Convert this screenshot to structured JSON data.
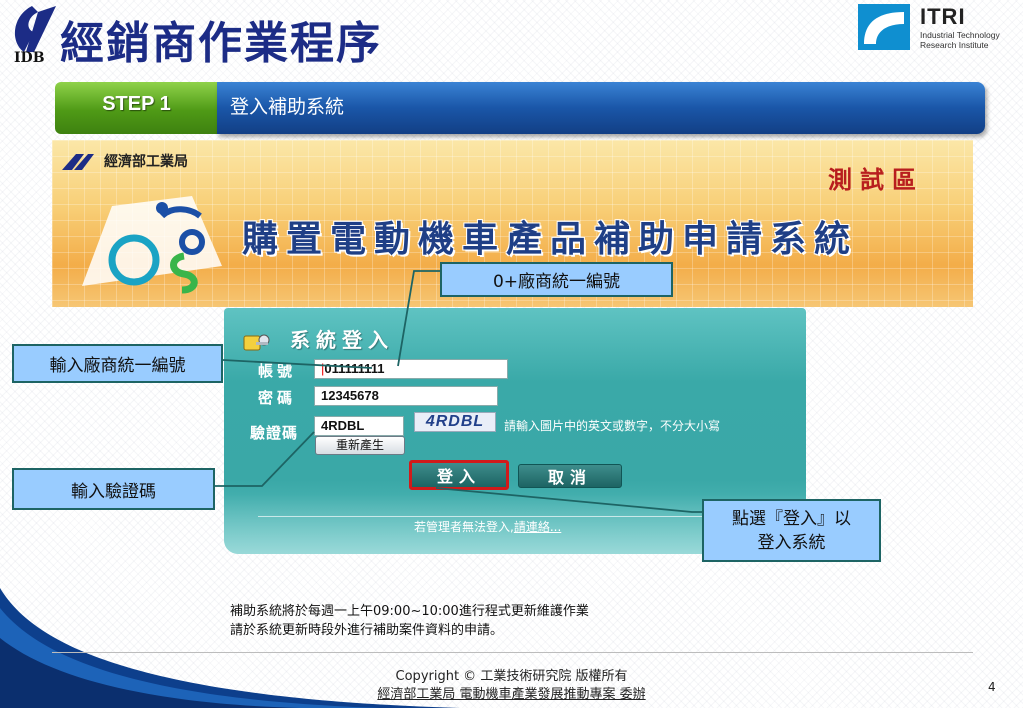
{
  "header": {
    "logo_text": "IDB",
    "title": "經銷商作業程序",
    "itri_name": "ITRI",
    "itri_sub_line1": "Industrial Technology",
    "itri_sub_line2": "Research Institute"
  },
  "step": {
    "badge": "STEP 1",
    "title": "登入補助系統"
  },
  "banner": {
    "ministry": "經濟部工業局",
    "test_zone": "測試區",
    "system_title": "購置電動機車產品補助申請系統"
  },
  "login": {
    "title": "系統登入",
    "account_label": "帳號",
    "account_caret": "|",
    "account_value": "011111111",
    "password_label": "密碼",
    "password_value": "12345678",
    "captcha_label": "驗證碼",
    "captcha_value": "4RDBL",
    "captcha_image_text": "4RDBL",
    "captcha_hint": "請輸入圖片中的英文或數字，不分大小寫",
    "regen_button": "重新產生",
    "login_button": "登入",
    "cancel_button": "取消",
    "contact_prefix": "若管理者無法登入,",
    "contact_link": "請連絡..."
  },
  "callouts": {
    "uniform_no": "0+廠商統一編號",
    "enter_account": "輸入廠商統一編號",
    "enter_captcha": "輸入驗證碼",
    "click_login_line1": "點選『登入』以",
    "click_login_line2": "登入系統"
  },
  "notice": {
    "line1": "補助系統將於每週一上午09:00~10:00進行程式更新維護作業",
    "line2": "請於系統更新時段外進行補助案件資料的申請。"
  },
  "footer": {
    "copyright": "Copyright © 工業技術研究院 版權所有",
    "sponsor": "經濟部工業局 電動機車產業發展推動專案 委辦",
    "page_number": "4"
  },
  "colors": {
    "title_navy": "#1c2c86",
    "step_green": "#4f9a16",
    "step_blue": "#1a56a8",
    "login_teal": "#3aa9a8",
    "callout_fill": "#99ccff",
    "test_red": "#b81e1e"
  }
}
